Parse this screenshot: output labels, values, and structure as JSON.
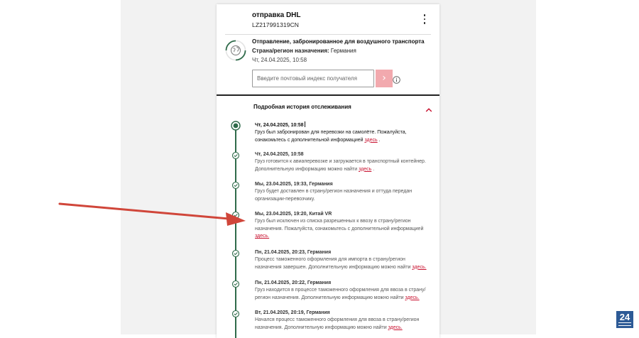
{
  "shipment": {
    "title": "отправка DHL",
    "tracking_number": "LZ217991319CN"
  },
  "status": {
    "title": "Отправление, забронированное для воздушного транспорта",
    "destination_label": "Страна/регион назначения:",
    "destination_value": "Германия",
    "date": "Чт, 24.04.2025, 10:58",
    "icon": "globe-icon"
  },
  "zip": {
    "placeholder": "Введите почтовый индекс получателя",
    "submit_label": "›"
  },
  "history": {
    "title": "Подробная история отслеживания",
    "events": [
      {
        "date": "Чт, 24.04.2025, 10:58",
        "desc": "Груз был забронирован для перевозки на самолёте. Пожалуйста, ознакомьтесь с дополнительной информацией ",
        "link": "здесь",
        "tail": " ."
      },
      {
        "date": "Чт, 24.04.2025, 10:58",
        "desc": "Груз готовится к авиаперевозке и загружается в транспортный контейнер. Дополнительную информацию можно найти ",
        "link": "здесь",
        "tail": " ."
      },
      {
        "date": "Мы, 23.04.2025, 19:33, Германия",
        "desc": "Груз будет доставлен в страну/регион назначения и оттуда передан организации-перевозчику.",
        "link": "",
        "tail": ""
      },
      {
        "date": "Мы, 23.04.2025, 19:20, Китай VR",
        "desc": "Груз был исключен из списка разрешенных к ввозу в страну/регион назначения. Пожалуйста, ознакомьтесь с дополнительной информацией ",
        "link": "здесь.",
        "tail": ""
      },
      {
        "date": "Пн, 21.04.2025, 20:23, Германия",
        "desc": "Процесс таможенного оформления для импорта в страну/регион назначения завершен. Дополнительную информацию можно найти ",
        "link": "здесь.",
        "tail": ""
      },
      {
        "date": "Пн, 21.04.2025, 20:22, Германия",
        "desc": "Груз находится в процессе таможенного оформления для ввоза в страну/ регион назначения. Дополнительную информацию можно найти ",
        "link": "здесь.",
        "tail": ""
      },
      {
        "date": "Вт, 21.04.2025, 20:19, Германия",
        "desc": "Начался процесс таможенного оформления для ввоза в страну/регион назначения. Дополнительную информацию можно найти ",
        "link": "здесь.",
        "tail": ""
      }
    ]
  },
  "badge": {
    "text": "24"
  },
  "colors": {
    "timeline": "#2f6b4a",
    "link": "#c8102e",
    "button": "#f2a9ae",
    "arrow": "#d0463a",
    "badge": "#2d5a96"
  }
}
